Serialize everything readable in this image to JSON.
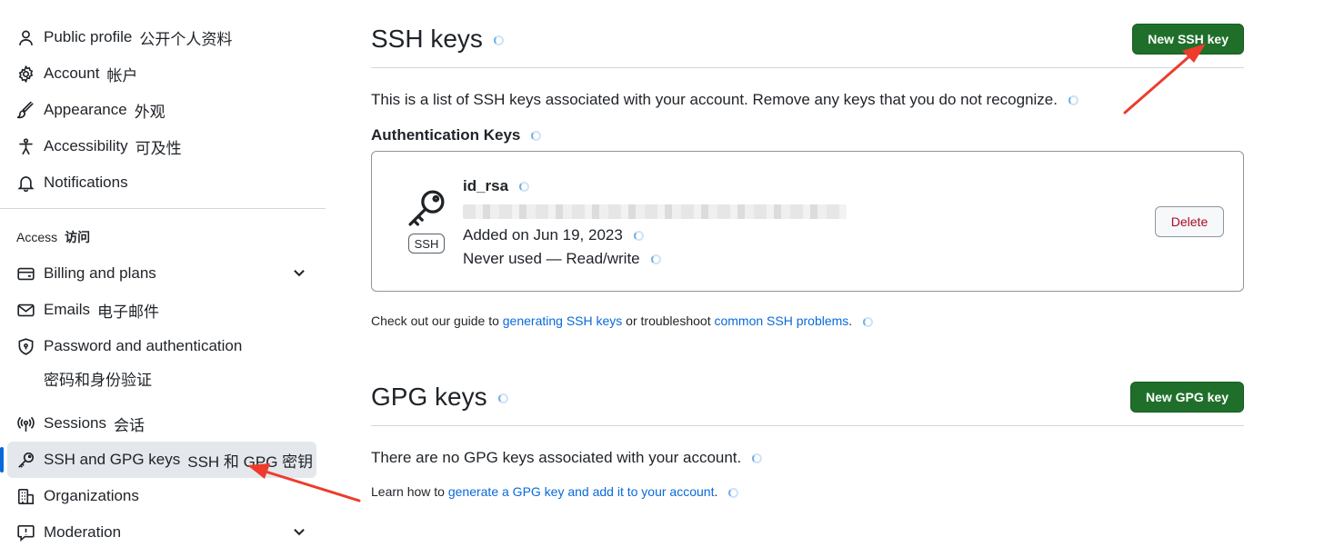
{
  "sidebar": {
    "items": [
      {
        "label": "Public profile",
        "zh": "公开个人资料",
        "icon": "person-icon"
      },
      {
        "label": "Account",
        "zh": "帐户",
        "icon": "gear-icon"
      },
      {
        "label": "Appearance",
        "zh": "外观",
        "icon": "paintbrush-icon"
      },
      {
        "label": "Accessibility",
        "zh": "可及性",
        "icon": "accessibility-icon"
      },
      {
        "label": "Notifications",
        "zh": "",
        "icon": "bell-icon"
      }
    ],
    "access_heading": {
      "label": "Access",
      "zh": "访问"
    },
    "access_items": [
      {
        "label": "Billing and plans",
        "zh": "",
        "icon": "credit-card-icon"
      },
      {
        "label": "Emails",
        "zh": "电子邮件",
        "icon": "mail-icon"
      },
      {
        "label": "Password and authentication",
        "zh": "密码和身份验证",
        "icon": "shield-lock-icon"
      },
      {
        "label": "Sessions",
        "zh": "会话",
        "icon": "broadcast-icon"
      },
      {
        "label": "SSH and GPG keys",
        "zh": "SSH 和 GPG 密钥",
        "icon": "key-icon",
        "active": true
      },
      {
        "label": "Organizations",
        "zh": "",
        "icon": "organization-icon"
      },
      {
        "label": "Moderation",
        "zh": "",
        "icon": "report-icon"
      }
    ]
  },
  "ssh": {
    "title": "SSH keys",
    "new_button": "New SSH key",
    "description": "This is a list of SSH keys associated with your account. Remove any keys that you do not recognize.",
    "auth_heading": "Authentication Keys",
    "key": {
      "name": "id_rsa",
      "badge": "SSH",
      "added": "Added on Jun 19, 2023",
      "usage": "Never used — Read/write",
      "delete_label": "Delete"
    },
    "guide_prefix": "Check out our guide to ",
    "guide_link1": "generating SSH keys",
    "guide_middle": " or troubleshoot ",
    "guide_link2": "common SSH problems",
    "guide_suffix": "."
  },
  "gpg": {
    "title": "GPG keys",
    "new_button": "New GPG key",
    "empty_text": "There are no GPG keys associated with your account.",
    "learn_prefix": "Learn how to ",
    "learn_link": "generate a GPG key and add it to your account",
    "learn_suffix": "."
  },
  "colors": {
    "accent_green": "#1f6f2b",
    "link_blue": "#0969da",
    "annotation_red": "#ee3b2c",
    "danger": "#a40e26"
  }
}
